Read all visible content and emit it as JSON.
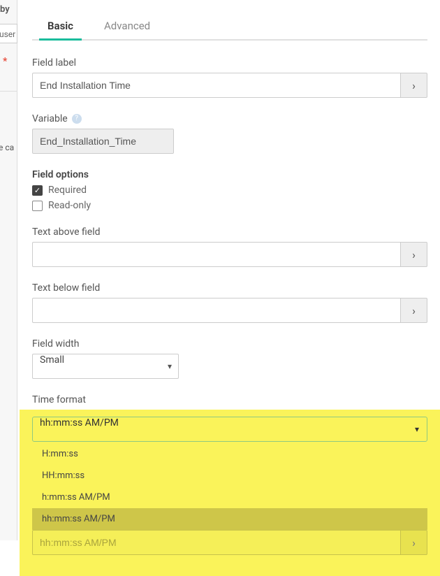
{
  "left": {
    "by": "by",
    "user": "user",
    "star": "*",
    "eca": "e ca"
  },
  "tabs": {
    "basic": "Basic",
    "advanced": "Advanced"
  },
  "labels": {
    "field_label": "Field label",
    "variable": "Variable",
    "field_options": "Field options",
    "text_above": "Text above field",
    "text_below": "Text below field",
    "field_width": "Field width",
    "time_format": "Time format"
  },
  "values": {
    "field_label": "End Installation Time",
    "variable": "End_Installation_Time",
    "text_above": "",
    "text_below": "",
    "field_width": "Small",
    "time_format": "hh:mm:ss AM/PM",
    "ghost": "hh:mm:ss AM/PM"
  },
  "checkboxes": {
    "required_label": "Required",
    "required_checked": true,
    "readonly_label": "Read-only",
    "readonly_checked": false
  },
  "time_format_options": [
    "H:mm:ss",
    "HH:mm:ss",
    "h:mm:ss AM/PM",
    "hh:mm:ss AM/PM"
  ],
  "selected_tf_option": "hh:mm:ss AM/PM"
}
